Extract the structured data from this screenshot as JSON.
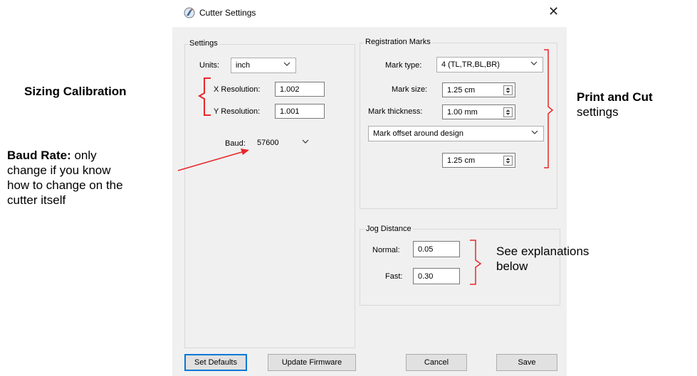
{
  "window": {
    "title": "Cutter Settings"
  },
  "settings": {
    "group_label": "Settings",
    "units_label": "Units:",
    "units_value": "inch",
    "x_res_label": "X Resolution:",
    "x_res_value": "1.002",
    "y_res_label": "Y Resolution:",
    "y_res_value": "1.001",
    "baud_label": "Baud:",
    "baud_value": "57600"
  },
  "registration": {
    "group_label": "Registration Marks",
    "mark_type_label": "Mark type:",
    "mark_type_value": "4 (TL,TR,BL,BR)",
    "mark_size_label": "Mark size:",
    "mark_size_value": "1.25 cm",
    "mark_thickness_label": "Mark thickness:",
    "mark_thickness_value": "1.00 mm",
    "offset_mode_value": "Mark offset around design",
    "offset_value": "1.25 cm"
  },
  "jog": {
    "group_label": "Jog Distance",
    "normal_label": "Normal:",
    "normal_value": "0.05",
    "fast_label": "Fast:",
    "fast_value": "0.30"
  },
  "buttons": {
    "set_defaults": "Set Defaults",
    "update_firmware": "Update Firmware",
    "cancel": "Cancel",
    "save": "Save"
  },
  "annotations": {
    "sizing": "Sizing Calibration",
    "baud_bold": "Baud Rate:",
    "baud_line1": " only",
    "baud_line2": "change if you know",
    "baud_line3": "how to change on the",
    "baud_line4": "cutter itself",
    "print_cut_bold": "Print and Cut",
    "print_cut_line2": "settings",
    "jog_line1": "See explanations",
    "jog_line2": "below"
  },
  "colors": {
    "annotation_red": "#e8272a",
    "focus_blue": "#0078d7"
  },
  "icons": {
    "app": "cutter-app-icon",
    "close": "close-icon",
    "dropdown": "chevron-down-icon",
    "spinner": "spin-updown-icon"
  }
}
